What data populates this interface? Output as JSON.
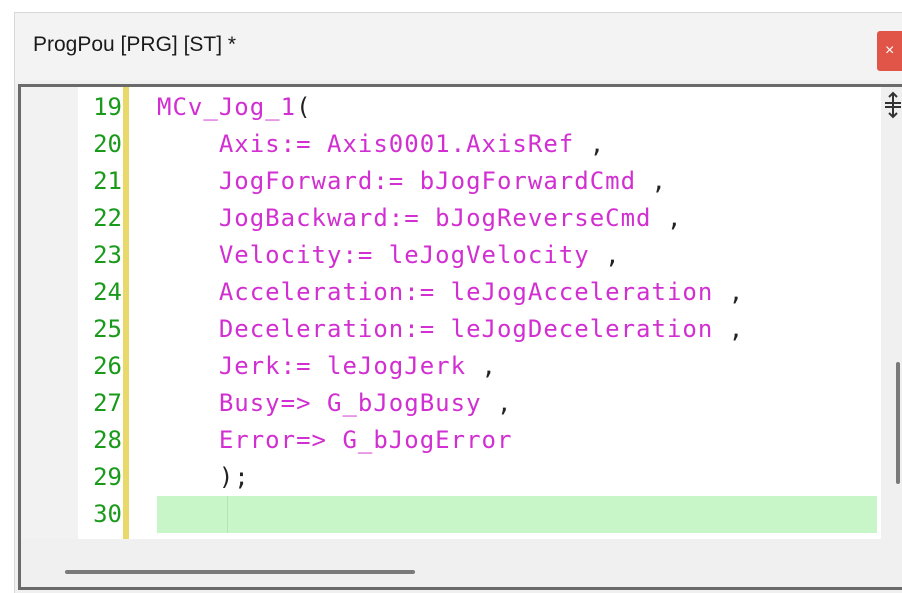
{
  "window": {
    "title": "ProgPou [PRG] [ST] *",
    "close_label": "×"
  },
  "editor": {
    "lines": [
      {
        "number": "19",
        "code": "MCv_Jog_1("
      },
      {
        "number": "20",
        "code": "    Axis:= Axis0001.AxisRef ,"
      },
      {
        "number": "21",
        "code": "    JogForward:= bJogForwardCmd ,"
      },
      {
        "number": "22",
        "code": "    JogBackward:= bJogReverseCmd ,"
      },
      {
        "number": "23",
        "code": "    Velocity:= leJogVelocity ,"
      },
      {
        "number": "24",
        "code": "    Acceleration:= leJogAcceleration ,"
      },
      {
        "number": "25",
        "code": "    Deceleration:= leJogDeceleration ,"
      },
      {
        "number": "26",
        "code": "    Jerk:= leJogJerk ,"
      },
      {
        "number": "27",
        "code": "    Busy=> G_bJogBusy ,"
      },
      {
        "number": "28",
        "code": "    Error=> G_bJogError"
      },
      {
        "number": "29",
        "code": "    );"
      },
      {
        "number": "30",
        "code": ""
      }
    ],
    "current_line": "30"
  },
  "colors": {
    "keyword_magenta": "#d12fd1",
    "line_number_green": "#1a9a1a",
    "current_line_highlight": "#c9f6c9",
    "change_bar_yellow": "#e8d96a",
    "close_red": "#e05548"
  },
  "icons": {
    "split": "split-handle-icon",
    "close": "close-icon"
  }
}
